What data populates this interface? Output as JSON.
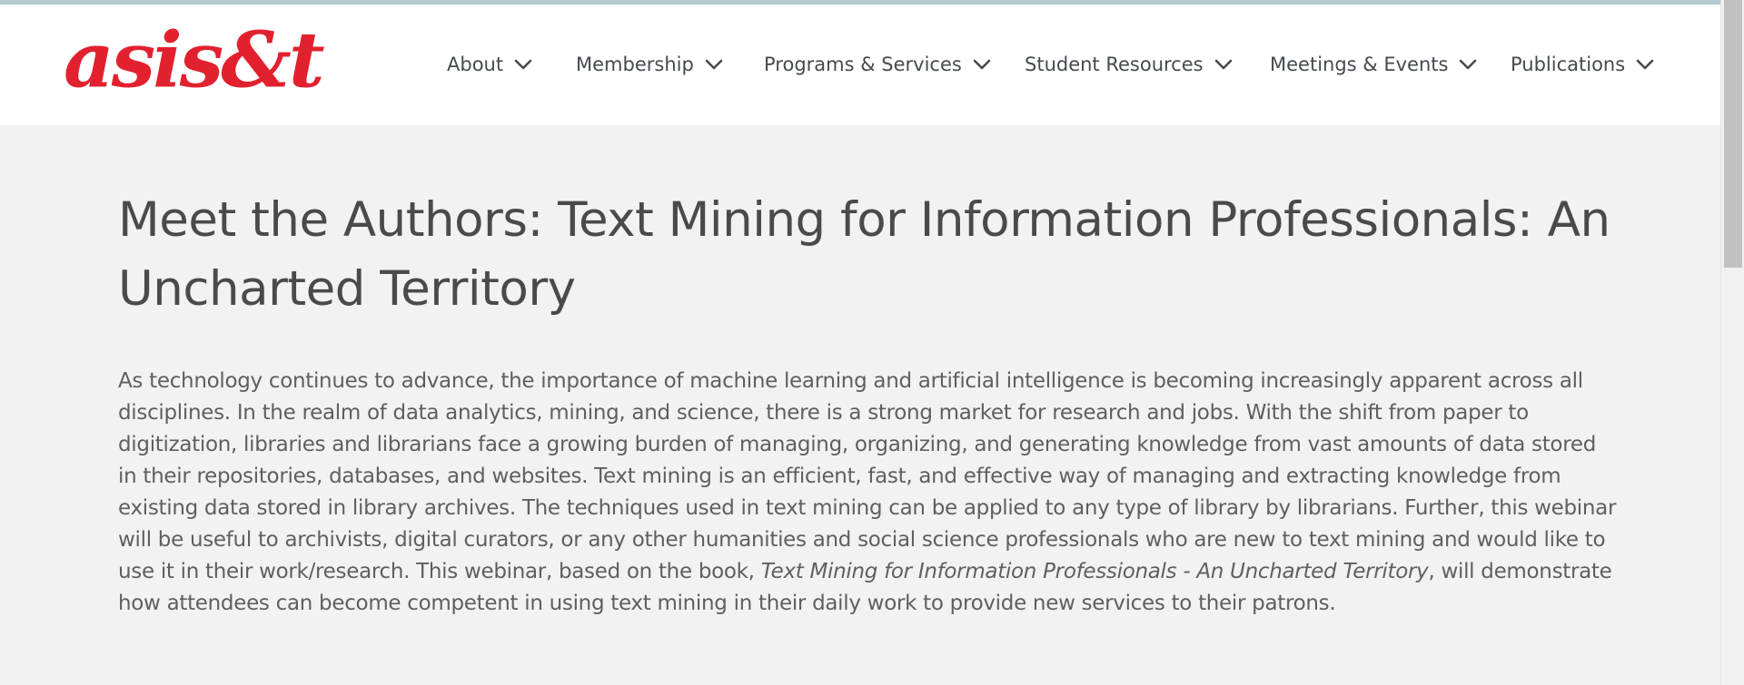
{
  "brand": {
    "logo_text": "asis&t",
    "accent_color": "#e2212f",
    "top_strip_color": "#b5cad3"
  },
  "nav": {
    "items": [
      {
        "label": "About"
      },
      {
        "label": "Membership"
      },
      {
        "label": "Programs & Services"
      },
      {
        "label": "Student Resources"
      },
      {
        "label": "Meetings & Events"
      },
      {
        "label": "Publications"
      }
    ],
    "chevron_icon": "chevron-down-icon"
  },
  "main": {
    "title": "Meet the Authors: Text Mining for Information Professionals: An Uncharted Territory",
    "description_part1": "As technology continues to advance, the importance of machine learning and artificial intelligence is becoming increasingly apparent across all disciplines. In the realm of data analytics, mining, and science, there is a strong market for research and jobs. With the shift from paper to digitization, libraries and librarians face a growing burden of managing, organizing, and generating knowledge from vast amounts of data stored in their repositories, databases, and websites. Text mining is an efficient, fast, and effective way of managing and extracting knowledge from existing data stored in library archives. The techniques used in text mining can be applied to any type of library by librarians. Further, this webinar will be useful to archivists, digital curators, or any other humanities and social science professionals who are new to text mining and would like to use it in their work/research. This webinar, based on the book, ",
    "description_book_title": "Text Mining for Information Professionals - An Uncharted Territory",
    "description_part2": ", will demonstrate how attendees can become competent in using text mining in their daily work to provide new services to their patrons."
  }
}
